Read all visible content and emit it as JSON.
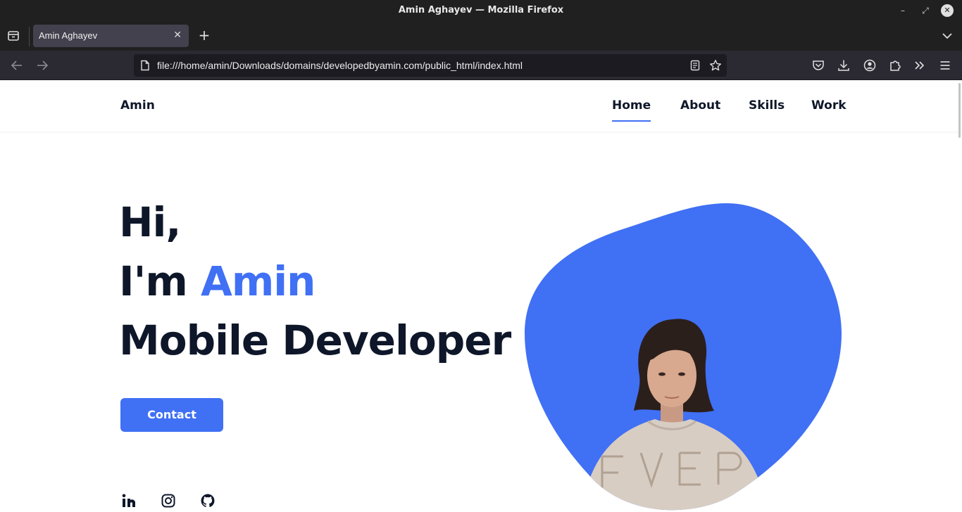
{
  "window": {
    "title": "Amin Aghayev — Mozilla Firefox",
    "minimize_symbol": "–",
    "maximize_symbol": "⤢",
    "close_symbol": "✕"
  },
  "tabs": [
    {
      "label": "Amin Aghayev",
      "active": true,
      "close_symbol": "✕"
    }
  ],
  "new_tab_symbol": "+",
  "toolbar": {
    "url": "file:///home/amin/Downloads/domains/developedbyamin.com/public_html/index.html",
    "icons": [
      "back-icon",
      "forward-icon",
      "page-icon",
      "reader-view-icon",
      "bookmark-star-icon",
      "pocket-icon",
      "downloads-icon",
      "account-icon",
      "extensions-icon",
      "overflow-icon",
      "menu-icon"
    ]
  },
  "site": {
    "logo": "Amin",
    "nav": [
      {
        "label": "Home",
        "active": true
      },
      {
        "label": "About",
        "active": false
      },
      {
        "label": "Skills",
        "active": false
      },
      {
        "label": "Work",
        "active": false
      }
    ],
    "hero": {
      "greeting": "Hi,",
      "intro": "I'm ",
      "name": "Amin",
      "role": "Mobile Developer"
    },
    "contact_button": "Contact",
    "social_icons": [
      "linkedin-icon",
      "instagram-icon",
      "github-icon"
    ],
    "social_text": {
      "linkedin": "in"
    }
  },
  "colors": {
    "accent": "#4070f4",
    "text_dark": "#0e1729",
    "chrome_dark": "#202020",
    "toolbar": "#2b2a33",
    "urlbar": "#1c1b22"
  }
}
